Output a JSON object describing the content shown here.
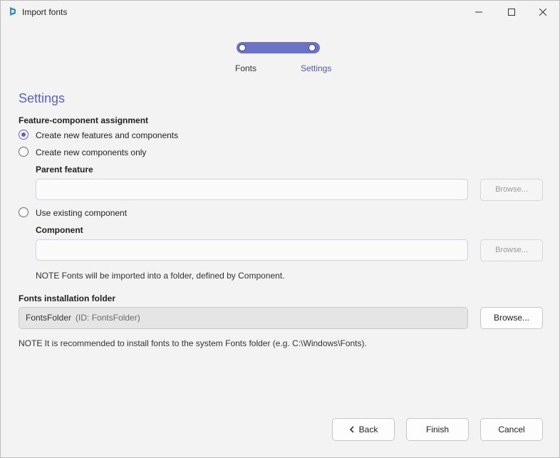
{
  "window": {
    "title": "Import fonts"
  },
  "stepper": {
    "steps": [
      "Fonts",
      "Settings"
    ],
    "current": "Settings"
  },
  "page_title": "Settings",
  "assignment": {
    "label": "Feature-component assignment",
    "options": [
      {
        "label": "Create new features and components",
        "selected": true
      },
      {
        "label": "Create new components only",
        "selected": false
      },
      {
        "label": "Use existing component",
        "selected": false
      }
    ],
    "parent_feature": {
      "label": "Parent feature",
      "value": "",
      "browse": "Browse..."
    },
    "component": {
      "label": "Component",
      "value": "",
      "browse": "Browse..."
    },
    "note": "NOTE Fonts will be imported into a folder, defined by Component."
  },
  "installation": {
    "label": "Fonts installation folder",
    "folder": "FontsFolder",
    "folder_id": "(ID: FontsFolder)",
    "browse": "Browse...",
    "note": "NOTE It is recommended to install fonts to the system Fonts folder (e.g. C:\\Windows\\Fonts)."
  },
  "footer": {
    "back": "Back",
    "finish": "Finish",
    "cancel": "Cancel"
  },
  "colors": {
    "accent": "#5b63bf",
    "track": "#6b73c6"
  }
}
